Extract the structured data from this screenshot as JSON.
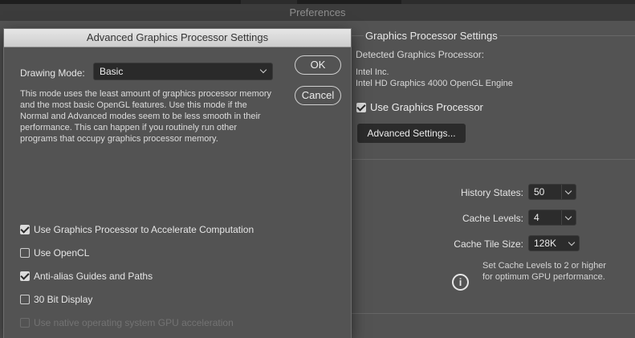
{
  "window": {
    "title": "Preferences"
  },
  "dialog": {
    "title": "Advanced Graphics Processor Settings",
    "drawing_mode_label": "Drawing Mode:",
    "drawing_mode_value": "Basic",
    "description": "This mode uses the least amount of graphics processor memory and the most basic OpenGL features.  Use this mode if the Normal and Advanced modes seem to be less smooth in their performance.  This can happen if you routinely run other programs that occupy graphics processor memory.",
    "ok_label": "OK",
    "cancel_label": "Cancel",
    "options": [
      {
        "label": "Use Graphics Processor to Accelerate Computation",
        "checked": true,
        "enabled": true
      },
      {
        "label": "Use OpenCL",
        "checked": false,
        "enabled": true
      },
      {
        "label": "Anti-alias Guides and Paths",
        "checked": true,
        "enabled": true
      },
      {
        "label": "30 Bit Display",
        "checked": false,
        "enabled": true
      },
      {
        "label": "Use native operating system GPU acceleration",
        "checked": false,
        "enabled": false
      }
    ]
  },
  "gpu_settings": {
    "group_title": "Graphics Processor Settings",
    "detected_label": "Detected Graphics Processor:",
    "vendor": "Intel Inc.",
    "engine": "Intel HD Graphics 4000 OpenGL Engine",
    "use_gpu_label": "Use Graphics Processor",
    "use_gpu_checked": true,
    "advanced_button_label": "Advanced Settings..."
  },
  "history_cache": {
    "history_states_label": "History States:",
    "history_states_value": "50",
    "cache_levels_label": "Cache Levels:",
    "cache_levels_value": "4",
    "cache_tile_size_label": "Cache Tile Size:",
    "cache_tile_size_value": "128K",
    "hint_line1": "Set Cache Levels to 2 or higher",
    "hint_line2": "for optimum GPU performance.",
    "info_icon": "info-icon"
  }
}
